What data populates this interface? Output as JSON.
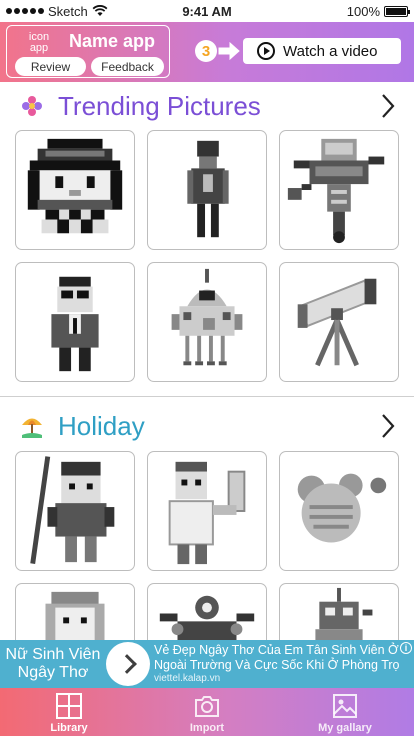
{
  "status_bar": {
    "carrier": "Sketch",
    "time": "9:41 AM",
    "battery": "100%",
    "battery_level": 1.0
  },
  "header": {
    "icon_label": "icon app",
    "app_name": "Name app",
    "review_label": "Review",
    "feedback_label": "Feedback",
    "coin_count": "3",
    "watch_video_label": "Watch a video",
    "gradient_start": "#f2748a",
    "gradient_end": "#b077e6"
  },
  "sections": [
    {
      "title": "Trending Pictures",
      "title_color": "#7b4fd6",
      "icon": "flower-icon",
      "tiles": [
        "pixel-girl-with-hat",
        "pixel-tall-man",
        "pixel-robot",
        "pixel-man-with-glasses",
        "pixel-rocket-robot",
        "pixel-telescope"
      ]
    },
    {
      "title": "Holiday",
      "title_color": "#2f9fc4",
      "icon": "beach-umbrella-icon",
      "tiles": [
        "pixel-hockey-player",
        "pixel-waving-man",
        "pixel-mouse",
        "pixel-girl-bob-hair",
        "pixel-spider-robot",
        "pixel-small-robot"
      ]
    }
  ],
  "ad": {
    "left_text": "Nữ Sinh Viên Ngây Thơ",
    "headline": "Vẻ Đẹp Ngây Thơ Của Em Tân Sinh Viên Ở Ngoài Trường Và Cực Sốc Khi Ở Phòng Trọ",
    "domain": "viettel.kalap.vn",
    "info_glyph": "i",
    "background": "#4fb0cf"
  },
  "tab_bar": {
    "tabs": [
      {
        "label": "Library",
        "icon": "grid-icon",
        "active": true
      },
      {
        "label": "Import",
        "icon": "camera-icon",
        "active": false
      },
      {
        "label": "My gallary",
        "icon": "image-icon",
        "active": false
      }
    ]
  }
}
